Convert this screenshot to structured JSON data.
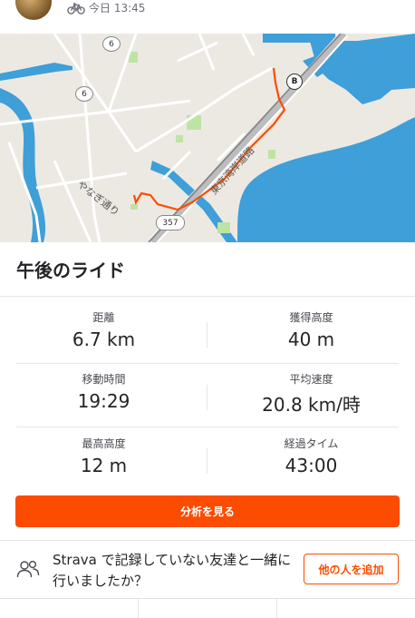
{
  "activity": {
    "date_time": "今日 13:45",
    "title": "午後のライド",
    "bike_icon": "bike-icon"
  },
  "map": {
    "roads": {
      "route_6a": "6",
      "route_6b": "6",
      "route_357": "357"
    },
    "street_labels": {
      "yanagi": "やなぎ通り",
      "highway": "東京湾岸道路"
    },
    "end_marker": "B",
    "colors": {
      "water": "#3f9fd8",
      "route": "#fc4c02",
      "park": "#bfe3a4",
      "land": "#ece9e3"
    }
  },
  "stats": [
    {
      "label": "距離",
      "value": "6.7 km"
    },
    {
      "label": "獲得高度",
      "value": "40 m"
    },
    {
      "label": "移動時間",
      "value": "19:29"
    },
    {
      "label": "平均速度",
      "value": "20.8 km/時"
    },
    {
      "label": "最高高度",
      "value": "12 m"
    },
    {
      "label": "経過タイム",
      "value": "43:00"
    }
  ],
  "cta": {
    "label": "分析を見る",
    "color": "#fc4c02"
  },
  "invite": {
    "text": "Strava で記録していない友達と一緒に行いましたか？",
    "button": "他の人を追加",
    "icon": "people-icon"
  }
}
